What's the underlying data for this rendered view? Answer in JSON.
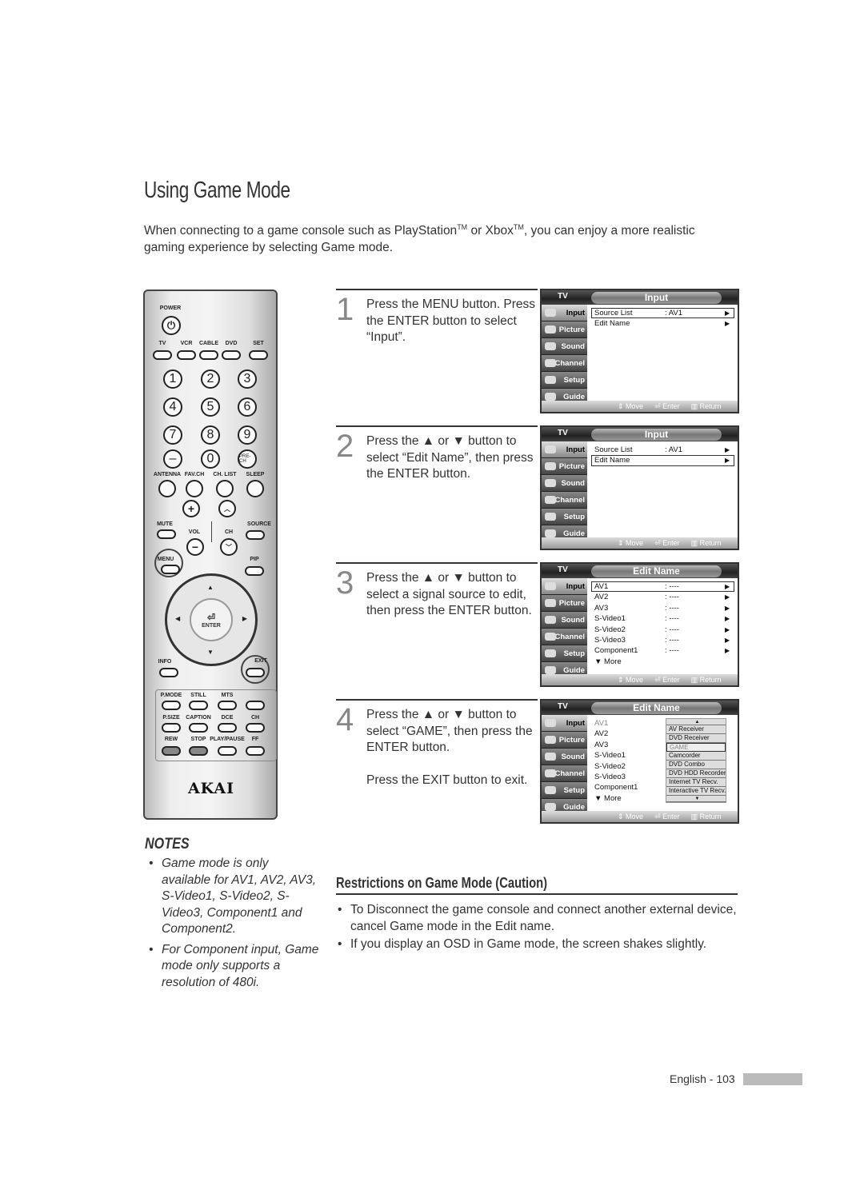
{
  "title": "Using Game Mode",
  "intro": {
    "before": "When connecting to a game console such as PlayStation",
    "tm1": "TM",
    "mid": " or Xbox",
    "tm2": "TM",
    "after": ", you can enjoy a more realistic gaming experience by selecting Game mode."
  },
  "remote": {
    "power_label": "POWER",
    "source_buttons": [
      "TV",
      "VCR",
      "CABLE",
      "DVD",
      "SET"
    ],
    "numbers": [
      "1",
      "2",
      "3",
      "4",
      "5",
      "6",
      "7",
      "8",
      "9",
      "–",
      "0",
      "PRE-CH"
    ],
    "function_row": [
      "ANTENNA",
      "FAV.CH",
      "CH. LIST",
      "SLEEP"
    ],
    "mute": "MUTE",
    "vol": "VOL",
    "ch": "CH",
    "source": "SOURCE",
    "menu": "MENU",
    "pip": "PIP",
    "enter": "ENTER",
    "info": "INFO",
    "exit": "EXIT",
    "bottom_rows": [
      [
        "P.MODE",
        "STILL",
        "MTS",
        ""
      ],
      [
        "P.SIZE",
        "CAPTION",
        "DCE",
        "CH"
      ],
      [
        "REW",
        "STOP",
        "PLAY/PAUSE",
        "FF"
      ]
    ],
    "brand": "AKAI"
  },
  "steps": [
    {
      "num": "1",
      "text": [
        "Press the MENU button. Press the ENTER button to select “Input”."
      ]
    },
    {
      "num": "2",
      "text": [
        "Press the ▲ or ▼ button to select “Edit Name”, then press the ENTER button."
      ]
    },
    {
      "num": "3",
      "text": [
        "Press the ▲ or ▼ button to select a signal source to edit, then press the ENTER button."
      ]
    },
    {
      "num": "4",
      "text": [
        "Press the ▲ or ▼ button to select “GAME”, then press the ENTER button.",
        "Press the EXIT button to exit."
      ]
    }
  ],
  "tv": {
    "label": "TV",
    "menu": [
      "Input",
      "Picture",
      "Sound",
      "Channel",
      "Setup",
      "Guide"
    ],
    "footer": [
      "Move",
      "Enter",
      "Return"
    ],
    "screens": [
      {
        "title": "Input",
        "rows": [
          {
            "k": "Source List",
            "v": ": AV1",
            "a": "▶",
            "hl": true
          },
          {
            "k": "Edit Name",
            "v": "",
            "a": "▶"
          }
        ]
      },
      {
        "title": "Input",
        "rows": [
          {
            "k": "Source List",
            "v": ": AV1",
            "a": "▶"
          },
          {
            "k": "Edit Name",
            "v": "",
            "a": "▶",
            "hl": true
          }
        ]
      },
      {
        "title": "Edit Name",
        "rows": [
          {
            "k": "AV1",
            "v": ": ----",
            "a": "▶",
            "hl": true
          },
          {
            "k": "AV2",
            "v": ": ----",
            "a": "▶"
          },
          {
            "k": "AV3",
            "v": ": ----",
            "a": "▶"
          },
          {
            "k": "S-Video1",
            "v": ": ----",
            "a": "▶"
          },
          {
            "k": "S-Video2",
            "v": ": ----",
            "a": "▶"
          },
          {
            "k": "S-Video3",
            "v": ": ----",
            "a": "▶"
          },
          {
            "k": "Component1",
            "v": ": ----",
            "a": "▶"
          },
          {
            "k": "▼ More",
            "v": "",
            "a": ""
          }
        ]
      },
      {
        "title": "Edit Name",
        "rows": [
          {
            "k": "AV1",
            "v": "",
            "a": "",
            "dim": true
          },
          {
            "k": "AV2",
            "v": "",
            "a": ""
          },
          {
            "k": "AV3",
            "v": "",
            "a": ""
          },
          {
            "k": "S-Video1",
            "v": "",
            "a": ""
          },
          {
            "k": "S-Video2",
            "v": "",
            "a": ""
          },
          {
            "k": "S-Video3",
            "v": "",
            "a": ""
          },
          {
            "k": "Component1",
            "v": "",
            "a": ""
          },
          {
            "k": "▼ More",
            "v": "",
            "a": ""
          }
        ],
        "list": [
          "▲",
          "AV Receiver",
          "DVD Receiver",
          "GAME",
          "Camcorder",
          "DVD Combo",
          "DVD HDD Recorder",
          "Internet TV Recv.",
          "Interactive TV Recv.",
          "▼"
        ],
        "selected": "GAME"
      }
    ]
  },
  "notes": {
    "heading": "NOTES",
    "items": [
      "Game mode is only available for AV1, AV2, AV3, S-Video1, S-Video2, S-Video3, Component1 and Component2.",
      "For Component input, Game mode only supports a resolution of 480i."
    ]
  },
  "restrictions": {
    "heading": "Restrictions on Game Mode (Caution)",
    "items": [
      "To Disconnect the game console and connect another external device, cancel Game mode in the Edit name.",
      "If you display an OSD in Game mode, the screen shakes slightly."
    ]
  },
  "footer": "English - 103"
}
